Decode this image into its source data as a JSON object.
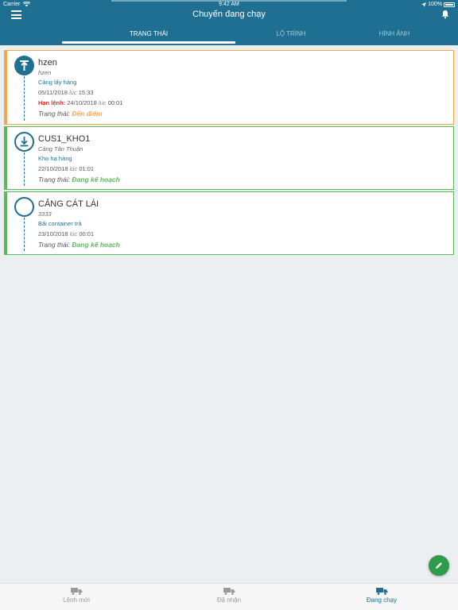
{
  "status_bar": {
    "carrier": "Carrier",
    "time": "9:42 AM",
    "battery": "100%"
  },
  "header": {
    "title": "Chuyến đang chạy"
  },
  "tabs": [
    {
      "label": "TRẠNG THÁI"
    },
    {
      "label": "LỘ TRÌNH"
    },
    {
      "label": "HÌNH ẢNH"
    }
  ],
  "cards": [
    {
      "name": "hzen",
      "sub": "hzen",
      "place": "Cảng lấy hàng",
      "date": "05/11/2018",
      "time_word": "lúc",
      "time": "15:33",
      "deadline_label": "Hạn lệnh:",
      "deadline_date": "24/10/2018",
      "deadline_time_word": "lúc",
      "deadline_time": "00:01",
      "status_label": "Trạng thái:",
      "status_value": "Đến điểm",
      "status_color": "#f2a94b"
    },
    {
      "name": "CUS1_KHO1",
      "sub": "Cảng Tân Thuận",
      "place": "Kho hạ hàng",
      "date": "22/10/2018",
      "time_word": "lúc",
      "time": "01:01",
      "status_label": "Trạng thái:",
      "status_value": "Đang kế hoạch",
      "status_color": "#5cb85c"
    },
    {
      "name": "CẢNG CÁT LÁI",
      "sub": "3333",
      "place": "Bãi container trả",
      "date": "23/10/2018",
      "time_word": "lúc",
      "time": "00:01",
      "status_label": "Trạng thái:",
      "status_value": "Đang kế hoạch",
      "status_color": "#5cb85c"
    }
  ],
  "bottom_nav": [
    {
      "label": "Lệnh mới",
      "icon": "truck-icon"
    },
    {
      "label": "Đã nhận",
      "icon": "truck-icon"
    },
    {
      "label": "Đang chạy",
      "icon": "truck-icon"
    }
  ],
  "colors": {
    "primary": "#1f6f93",
    "orange": "#f2a94b",
    "green": "#5cb85c",
    "fab": "#2e9c4a"
  }
}
